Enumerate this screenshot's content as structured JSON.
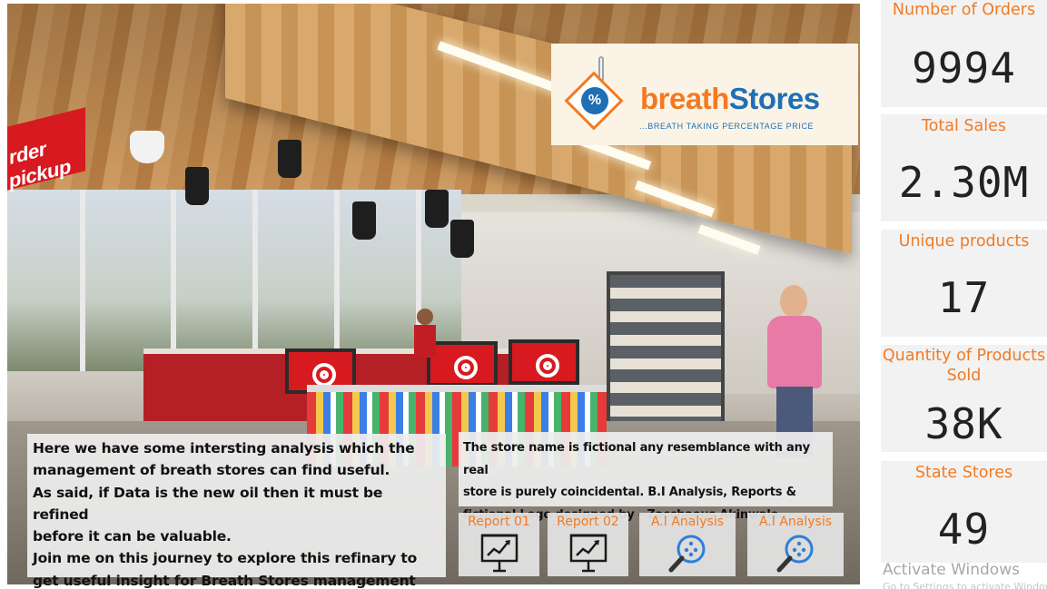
{
  "logo": {
    "name_part1": "breath",
    "name_part2": "Stores",
    "slogan": "...BREATH TAKING PERCENTAGE PRICE",
    "symbol": "%",
    "colors": {
      "orange": "#f37a21",
      "blue": "#1f6fb4"
    }
  },
  "photo": {
    "sign_text": "rder pickup"
  },
  "intro_panel": {
    "lines": [
      "Here we have some intersting analysis which the",
      "management of breath stores can find useful.",
      "As said, if Data is the new oil then it must be refined",
      "before it can be valuable.",
      "Join me on this journey to explore this refinary to",
      "get useful insight for Breath Stores management"
    ]
  },
  "disclaimer_panel": {
    "lines": [
      "The store name is fictional any resemblance with any real",
      "store is purely coincidental. B.I Analysis, Reports &",
      "fictional Logo designed by - Zacchaeus Akinwale."
    ]
  },
  "nav": {
    "buttons": [
      {
        "label": "Report 01",
        "icon": "presentation-chart-icon"
      },
      {
        "label": "Report 02",
        "icon": "presentation-chart-icon"
      },
      {
        "label": "A.I Analysis",
        "icon": "magnifier-icon"
      },
      {
        "label": "A.I Analysis",
        "icon": "magnifier-icon"
      }
    ]
  },
  "kpis": [
    {
      "title": "Number of Orders",
      "value": "9994"
    },
    {
      "title": "Total Sales",
      "value": "2.30M"
    },
    {
      "title": "Unique products",
      "value": "17"
    },
    {
      "title": "Quantity of Products Sold",
      "title_line1": "Quantity of Products",
      "title_line2": "Sold",
      "value": "38K"
    },
    {
      "title": "State Stores",
      "value": "49"
    }
  ],
  "watermark": {
    "title": "Activate Windows",
    "subtitle": "Go to Settings to activate Windows."
  },
  "accent_color": "#f37a21"
}
